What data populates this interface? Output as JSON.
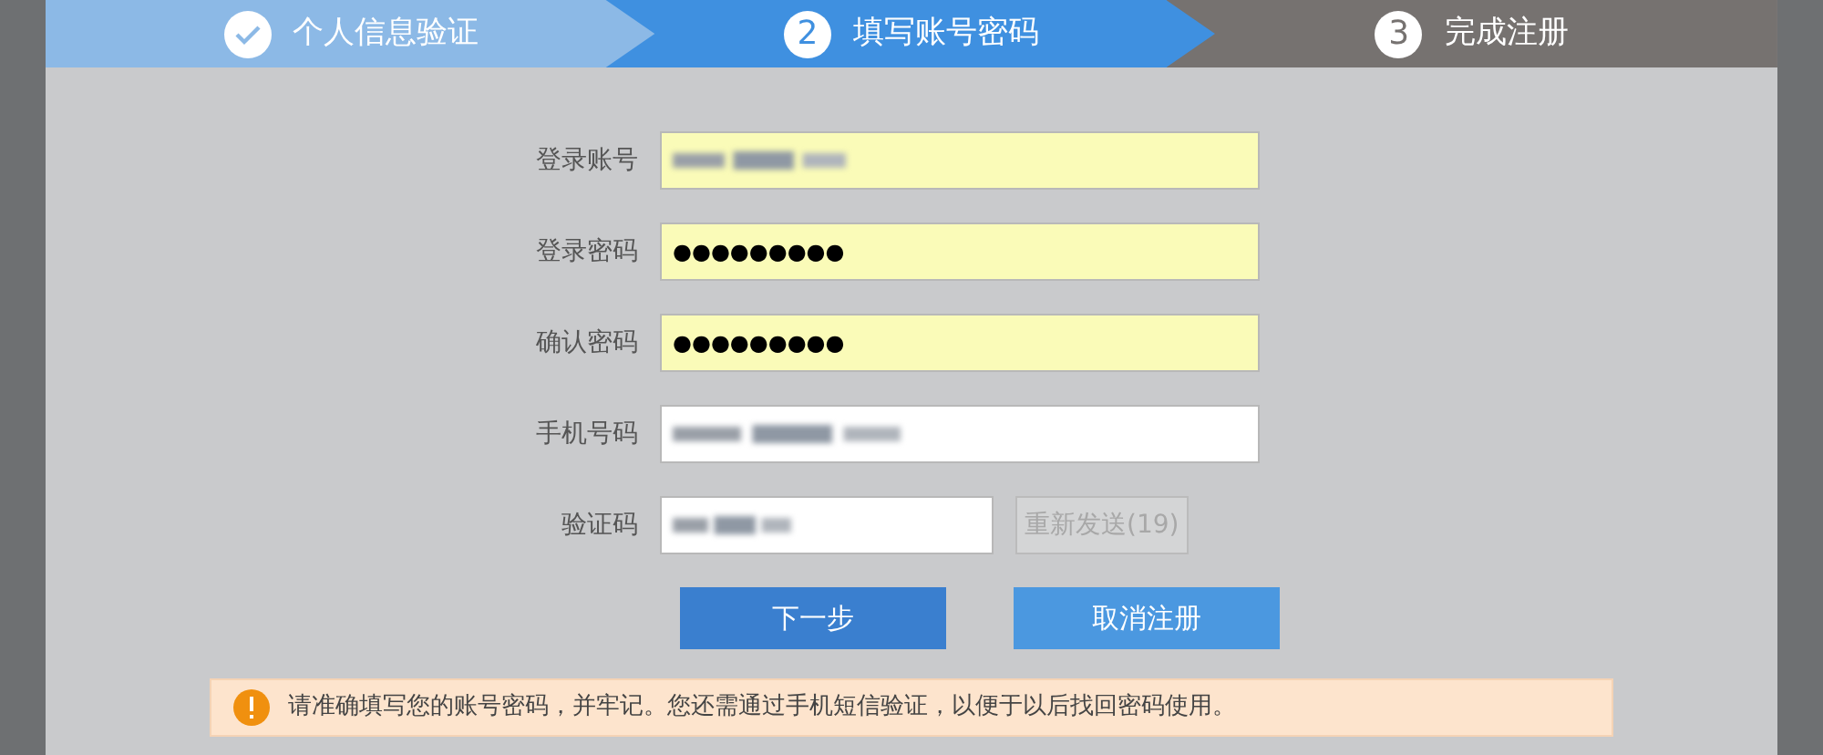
{
  "steps": [
    {
      "label": "个人信息验证",
      "completed": true,
      "selected": false
    },
    {
      "number": "2",
      "label": "填写账号密码",
      "completed": false,
      "selected": true
    },
    {
      "number": "3",
      "label": "完成注册",
      "completed": false,
      "selected": false
    }
  ],
  "fields": [
    {
      "label": "登录账号",
      "kind": "blurred",
      "autofilled": true
    },
    {
      "label": "登录密码",
      "kind": "password",
      "value": "●●●●●●●●●",
      "autofilled": true
    },
    {
      "label": "确认密码",
      "kind": "password",
      "value": "●●●●●●●●●",
      "autofilled": true
    },
    {
      "label": "手机号码",
      "kind": "blurred",
      "autofilled": false
    },
    {
      "label": "验证码",
      "kind": "blurred",
      "autofilled": false,
      "action": {
        "label": "重新发送(19)",
        "disabled": true
      }
    }
  ],
  "buttons": [
    {
      "label": "下一步",
      "kind": "primary"
    },
    {
      "label": "取消注册",
      "kind": "secondary"
    }
  ],
  "notice": "请准确填写您的账号密码，并牢记。您还需通过手机短信验证，以便于以后找回密码使用。"
}
